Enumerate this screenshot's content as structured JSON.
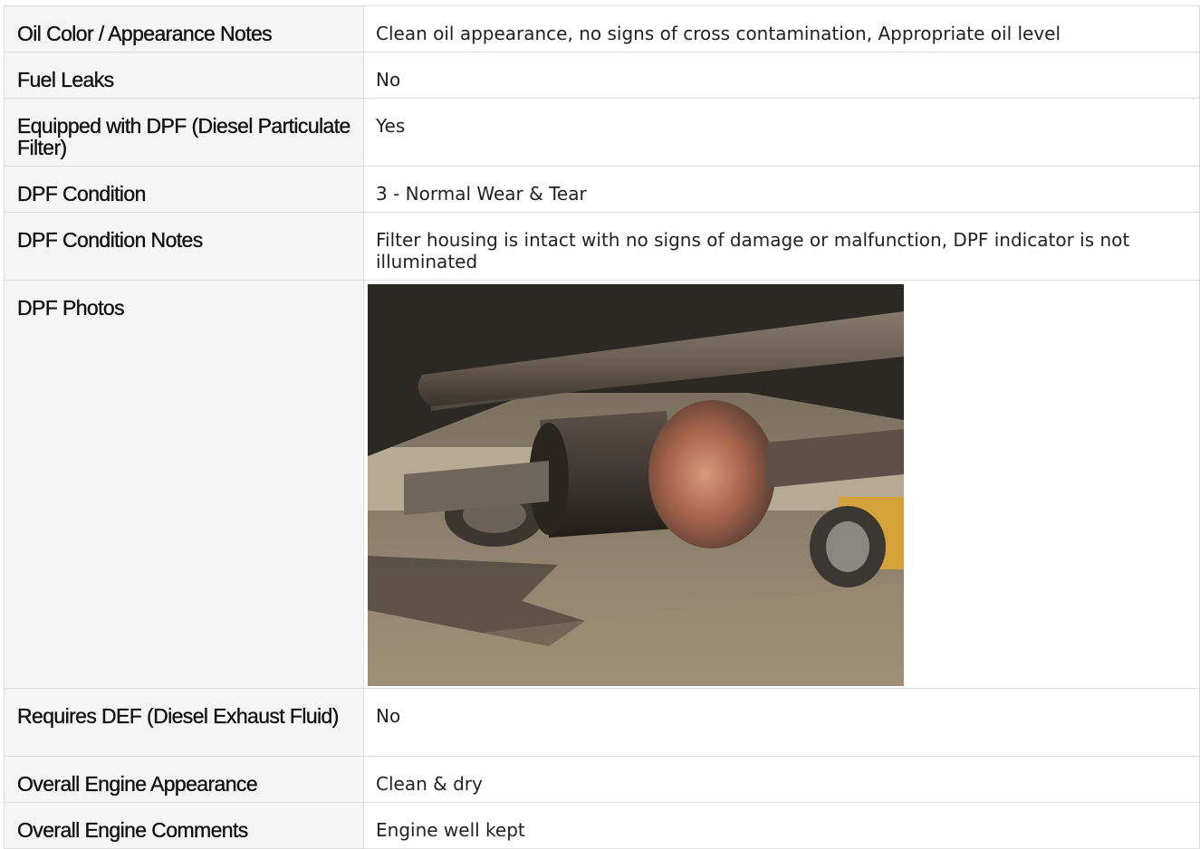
{
  "rows": [
    {
      "label": "Oil Color / Appearance Notes",
      "value": "Clean oil appearance, no signs of cross contamination, Appropriate oil level"
    },
    {
      "label": "Fuel Leaks",
      "value": "No"
    },
    {
      "label": "Equipped with DPF (Diesel Particulate Filter)",
      "value": "Yes"
    },
    {
      "label": "DPF Condition",
      "value": "3 - Normal Wear & Tear"
    },
    {
      "label": "DPF Condition Notes",
      "value": "Filter housing is intact with no signs of damage or malfunction, DPF indicator is not illuminated"
    },
    {
      "label": "DPF Photos",
      "photo": "dpf-underside-photo"
    },
    {
      "label": "Requires DEF (Diesel Exhaust Fluid)",
      "value": "No"
    },
    {
      "label": "Overall Engine Appearance",
      "value": "Clean & dry"
    },
    {
      "label": "Overall Engine Comments",
      "value": "Engine well kept"
    }
  ],
  "colors": {
    "label_background": "#f5f5f5",
    "border": "#dcdcdc",
    "text": "#111111"
  }
}
